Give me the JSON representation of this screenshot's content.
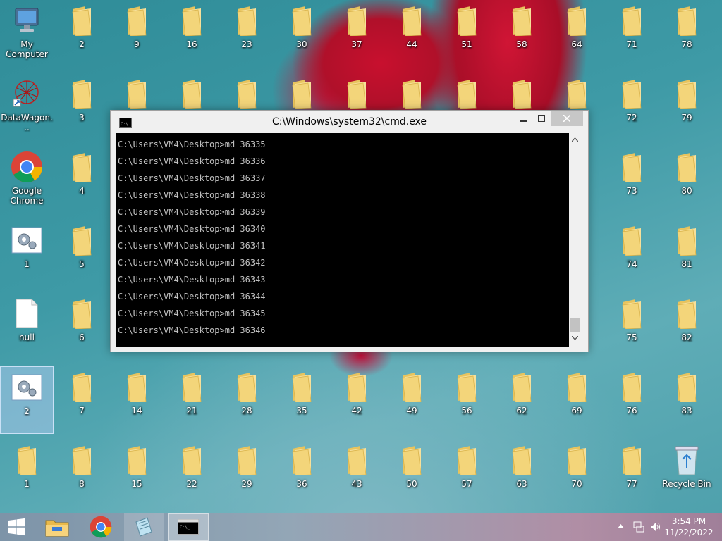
{
  "desktop": {
    "icons": [
      {
        "label": "My Computer",
        "icon": "computer-icon"
      },
      {
        "label": "DataWagon...",
        "icon": "datawagon-icon"
      },
      {
        "label": "Google Chrome",
        "icon": "chrome-icon"
      },
      {
        "label": "1",
        "icon": "settings-file-icon"
      },
      {
        "label": "null",
        "icon": "blank-file-icon"
      },
      {
        "label": "2",
        "icon": "settings-file-icon"
      },
      {
        "label": "1",
        "icon": "folder-icon"
      },
      {
        "label": "Recycle Bin",
        "icon": "recycle-bin-icon"
      }
    ],
    "folders": {
      "col2": [
        "2",
        "3",
        "4",
        "5",
        "6",
        "7",
        "8"
      ],
      "col3_top": [
        "9"
      ],
      "col3_bottom": [
        "14",
        "15"
      ],
      "col4_top": [
        "16"
      ],
      "col4_bottom": [
        "21",
        "22"
      ],
      "col5_top": [
        "23"
      ],
      "col5_bottom": [
        "28",
        "29"
      ],
      "col6_top": [
        "30"
      ],
      "col6_bottom": [
        "35",
        "36"
      ],
      "col7_top": [
        "37"
      ],
      "col7_bottom": [
        "42",
        "43"
      ],
      "col8_top": [
        "44"
      ],
      "col8_bottom": [
        "49",
        "50"
      ],
      "col9_top": [
        "51"
      ],
      "col9_bottom": [
        "56",
        "57"
      ],
      "col10_top": [
        "58"
      ],
      "col10_bottom": [
        "62",
        "63"
      ],
      "col11_top": [
        "64"
      ],
      "col11_bottom": [
        "69",
        "70"
      ],
      "col12": [
        "71",
        "72",
        "73",
        "74",
        "75",
        "76",
        "77"
      ],
      "col13": [
        "78",
        "79",
        "80",
        "81",
        "82",
        "83"
      ]
    }
  },
  "cmd": {
    "title": "C:\\Windows\\system32\\cmd.exe",
    "lines": [
      "C:\\Users\\VM4\\Desktop>md 36335",
      "C:\\Users\\VM4\\Desktop>md 36336",
      "C:\\Users\\VM4\\Desktop>md 36337",
      "C:\\Users\\VM4\\Desktop>md 36338",
      "C:\\Users\\VM4\\Desktop>md 36339",
      "C:\\Users\\VM4\\Desktop>md 36340",
      "C:\\Users\\VM4\\Desktop>md 36341",
      "C:\\Users\\VM4\\Desktop>md 36342",
      "C:\\Users\\VM4\\Desktop>md 36343",
      "C:\\Users\\VM4\\Desktop>md 36344",
      "C:\\Users\\VM4\\Desktop>md 36345",
      "C:\\Users\\VM4\\Desktop>md 36346"
    ]
  },
  "taskbar": {
    "time": "3:54 PM",
    "date": "11/22/2022",
    "buttons": [
      "start-button",
      "file-explorer",
      "google-chrome",
      "notepad-app",
      "cmd-app"
    ]
  },
  "colors": {
    "folder_yellow": "#f3d57a",
    "cmd_bg": "#000000",
    "cmd_text": "#c0c0c0"
  }
}
